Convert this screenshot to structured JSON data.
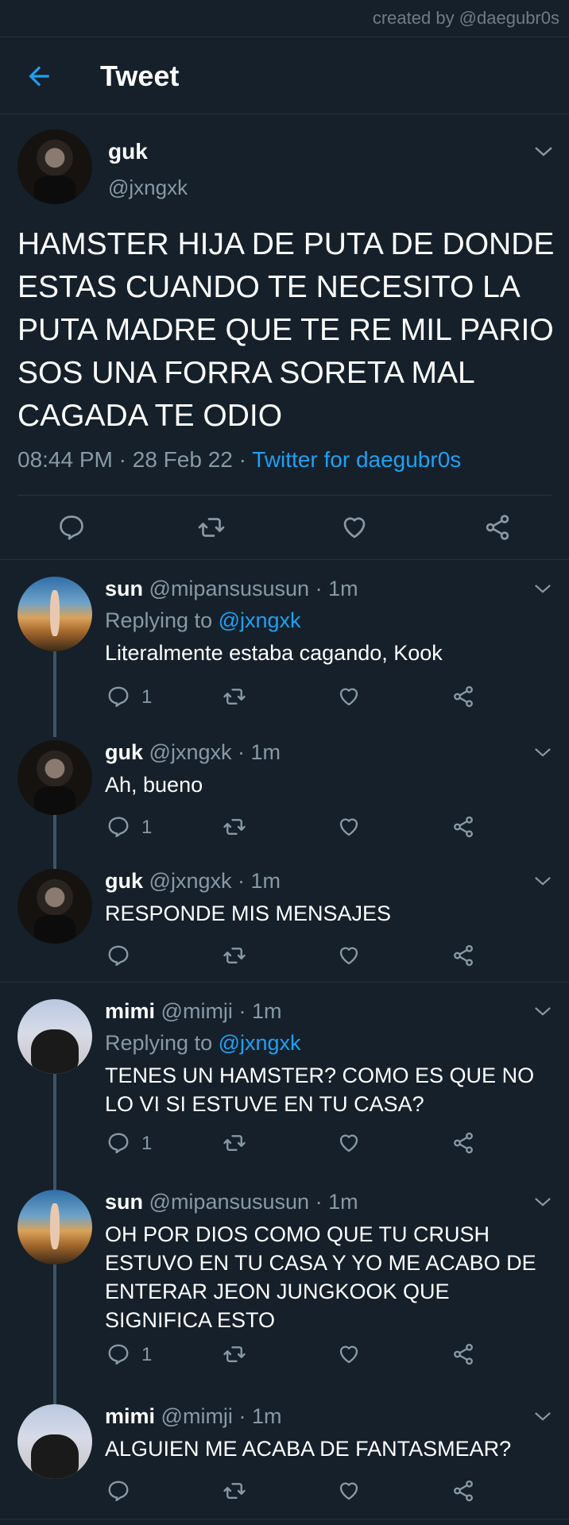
{
  "watermark": "created by @daegubr0s",
  "header": {
    "title": "Tweet"
  },
  "main_tweet": {
    "name": "guk",
    "handle": "@jxngxk",
    "text": "HAMSTER HIJA DE PUTA DE DONDE ESTAS CUANDO TE NECESITO LA PUTA MADRE QUE TE RE MIL PARIO SOS UNA FORRA SORETA MAL CAGADA TE ODIO",
    "time": "08:44 PM",
    "date": "28 Feb 22",
    "source": "Twitter for daegubr0s"
  },
  "replies": [
    {
      "name": "sun",
      "handle": "@mipansususun",
      "time": "1m",
      "replying_label": "Replying to",
      "replying_to": "@jxngxk",
      "text": "Literalmente estaba cagando, Kook",
      "reply_count": "1",
      "avatar": "sun"
    },
    {
      "name": "guk",
      "handle": "@jxngxk",
      "time": "1m",
      "text": "Ah, bueno",
      "reply_count": "1",
      "avatar": "guk"
    },
    {
      "name": "guk",
      "handle": "@jxngxk",
      "time": "1m",
      "text": "RESPONDE MIS MENSAJES",
      "reply_count": "",
      "avatar": "guk"
    },
    {
      "name": "mimi",
      "handle": "@mimji",
      "time": "1m",
      "replying_label": "Replying to",
      "replying_to": "@jxngxk",
      "text": "TENES UN HAMSTER? COMO ES QUE NO LO VI SI ESTUVE EN TU CASA?",
      "reply_count": "1",
      "avatar": "mimi"
    },
    {
      "name": "sun",
      "handle": "@mipansususun",
      "time": "1m",
      "text": "OH POR DIOS COMO QUE TU CRUSH ESTUVO EN TU CASA Y YO ME ACABO DE ENTERAR JEON JUNGKOOK QUE SIGNIFICA ESTO",
      "reply_count": "1",
      "avatar": "sun"
    },
    {
      "name": "mimi",
      "handle": "@mimji",
      "time": "1m",
      "text": "ALGUIEN ME ACABA DE FANTASMEAR?",
      "reply_count": "",
      "avatar": "mimi"
    }
  ],
  "icons": {
    "back": "back-arrow-icon",
    "reply": "reply-icon",
    "retweet": "retweet-icon",
    "like": "heart-icon",
    "share": "share-icon",
    "more": "chevron-down-icon"
  },
  "colors": {
    "background": "#15202b",
    "accent": "#1da1f2",
    "secondary_text": "#8899a6",
    "divider": "#253341",
    "thread_line": "#3d5466"
  }
}
